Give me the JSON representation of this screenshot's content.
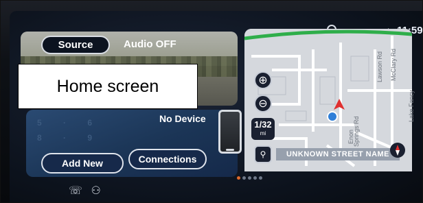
{
  "status_bar": {
    "time": "11:59",
    "settings_icon": "gear-icon",
    "signal_icon": "signal-icon"
  },
  "audio": {
    "source_label": "Source",
    "status": "Audio OFF"
  },
  "phone": {
    "status": "No Device",
    "add_new_label": "Add New",
    "connections_label": "Connections",
    "keypad_ghost": "1 2 3 4 5 6 7 8 9"
  },
  "map": {
    "zoom_in_icon": "zoom-in-icon",
    "zoom_out_icon": "zoom-out-icon",
    "scale_value": "1/32",
    "scale_unit": "mi",
    "street_name": "UNKNOWN STREET NAME",
    "roads": [
      "Lawson Rd",
      "McClary Rd",
      "Lake Fancy",
      "Enon",
      "Springs Rd"
    ]
  },
  "pager": {
    "pages": 5,
    "active": 0
  },
  "bottom": {
    "icons": [
      "phone-icon",
      "voice-icon"
    ]
  },
  "annotation": {
    "label": "Home screen"
  },
  "colors": {
    "accent": "#e06a2c",
    "card_blue": "#1b3556",
    "map_bg": "#d5d8dd",
    "route_green": "#2fae4a",
    "nav_arrow": "#e03030"
  }
}
